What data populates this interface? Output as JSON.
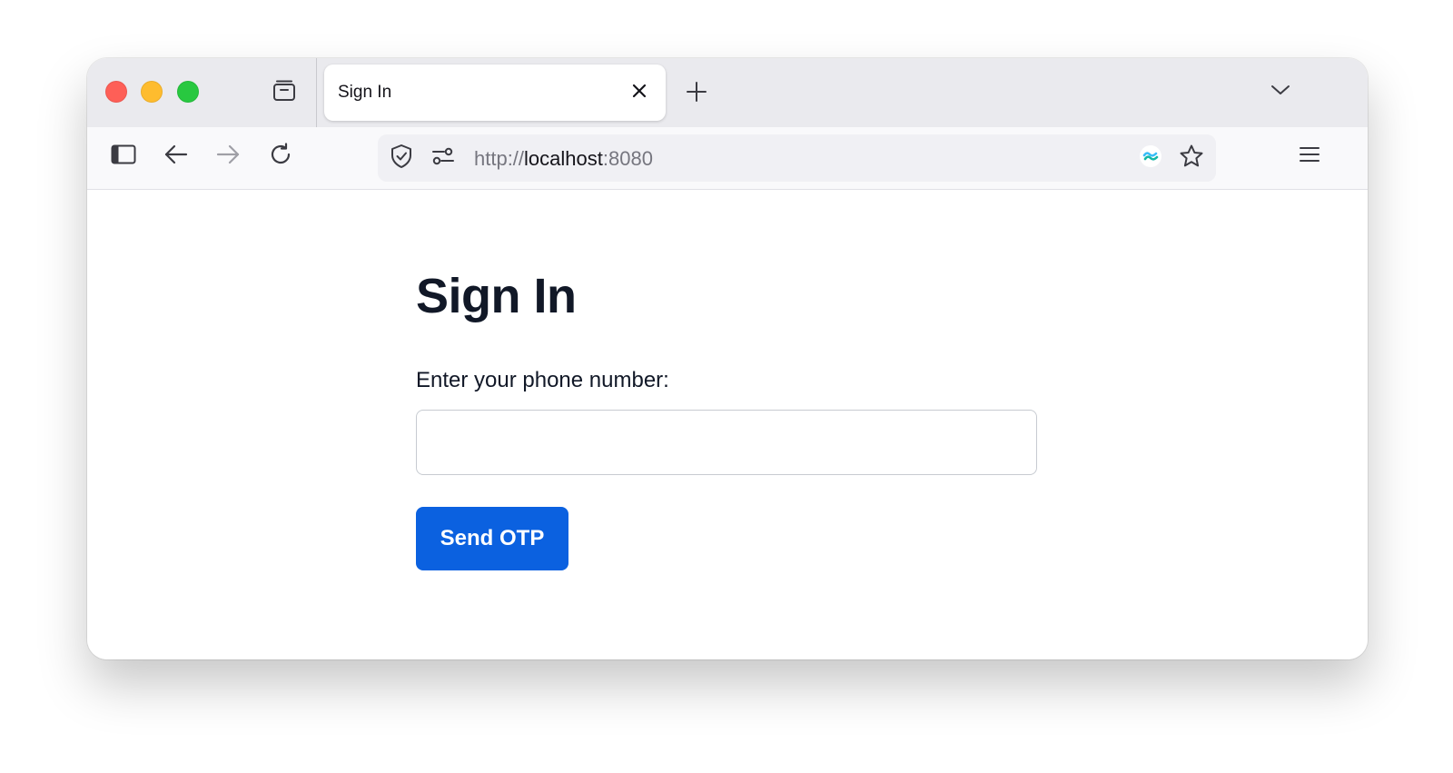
{
  "browser": {
    "tab": {
      "title": "Sign In"
    },
    "address_bar": {
      "scheme": "http://",
      "host": "localhost",
      "port": ":8080"
    },
    "icons": {
      "tab_view": "tab-overview-icon",
      "tab_close": "close-icon",
      "new_tab": "plus-icon",
      "list_all_tabs": "chevron-down-icon",
      "sidebar": "sidebar-icon",
      "back": "arrow-left-icon",
      "forward": "arrow-right-icon",
      "reload": "reload-icon",
      "tracking_protection": "shield-icon",
      "permissions": "permissions-icon",
      "extension": "extension-icon",
      "bookmark": "star-icon",
      "menu": "hamburger-menu-icon"
    },
    "colors": {
      "traffic_close": "#fe5f57",
      "traffic_minimize": "#febc2e",
      "traffic_maximize": "#28c840"
    }
  },
  "page": {
    "title": "Sign In",
    "phone_label": "Enter your phone number:",
    "phone_value": "",
    "send_button_label": "Send OTP",
    "colors": {
      "accent": "#0b61e0",
      "heading": "#111827"
    }
  }
}
